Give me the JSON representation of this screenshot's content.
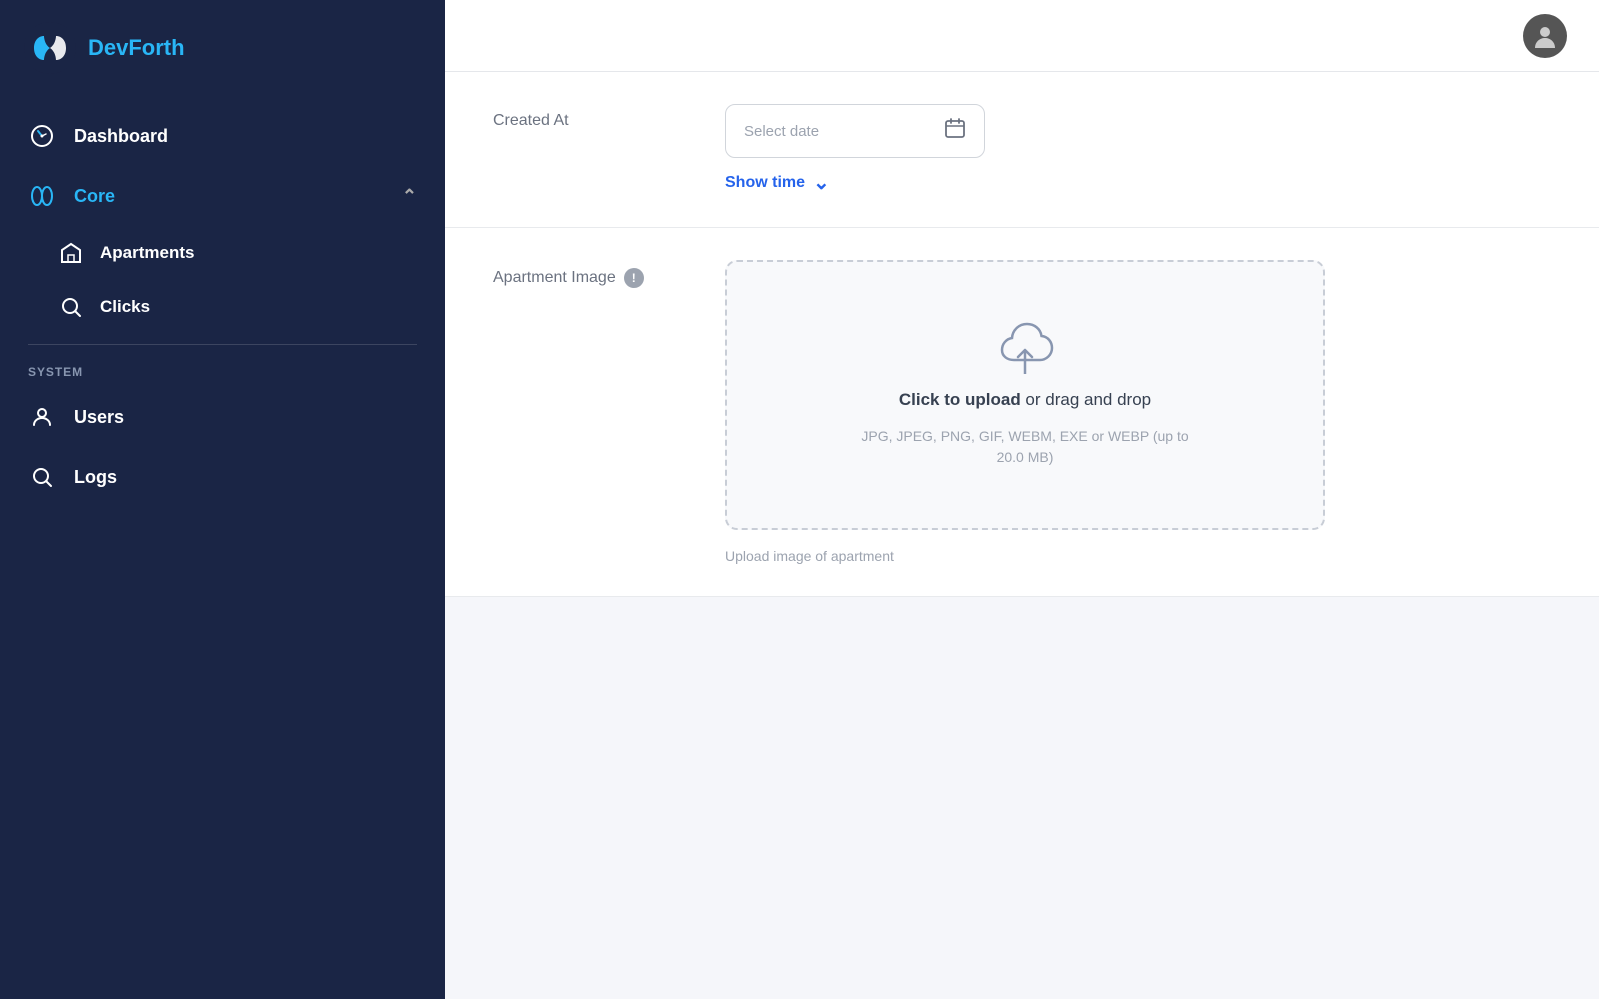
{
  "app": {
    "name": "DevForth",
    "name_colored": "Dev",
    "name_rest": "Forth"
  },
  "sidebar": {
    "section_system": "SYSTEM",
    "items": [
      {
        "id": "dashboard",
        "label": "Dashboard",
        "icon": "dashboard-icon",
        "active": false
      },
      {
        "id": "core",
        "label": "Core",
        "icon": "core-icon",
        "active": true,
        "expanded": true
      },
      {
        "id": "apartments",
        "label": "Apartments",
        "icon": "apartments-icon",
        "sub": true
      },
      {
        "id": "clicks",
        "label": "Clicks",
        "icon": "clicks-icon",
        "sub": true
      },
      {
        "id": "users",
        "label": "Users",
        "icon": "users-icon",
        "system": true
      },
      {
        "id": "logs",
        "label": "Logs",
        "icon": "logs-icon",
        "system": true
      }
    ]
  },
  "form": {
    "created_at_label": "Created At",
    "date_placeholder": "Select date",
    "show_time_label": "Show time",
    "apartment_image_label": "Apartment Image",
    "upload_click_label": "Click to upload",
    "upload_or": " or drag and drop",
    "upload_formats": "JPG, JPEG, PNG, GIF, WEBM, EXE or WEBP (up to 20.0 MB)",
    "upload_caption": "Upload image of apartment"
  },
  "colors": {
    "sidebar_bg": "#1a2545",
    "accent_blue": "#2563eb",
    "accent_cyan": "#29b6f6"
  }
}
